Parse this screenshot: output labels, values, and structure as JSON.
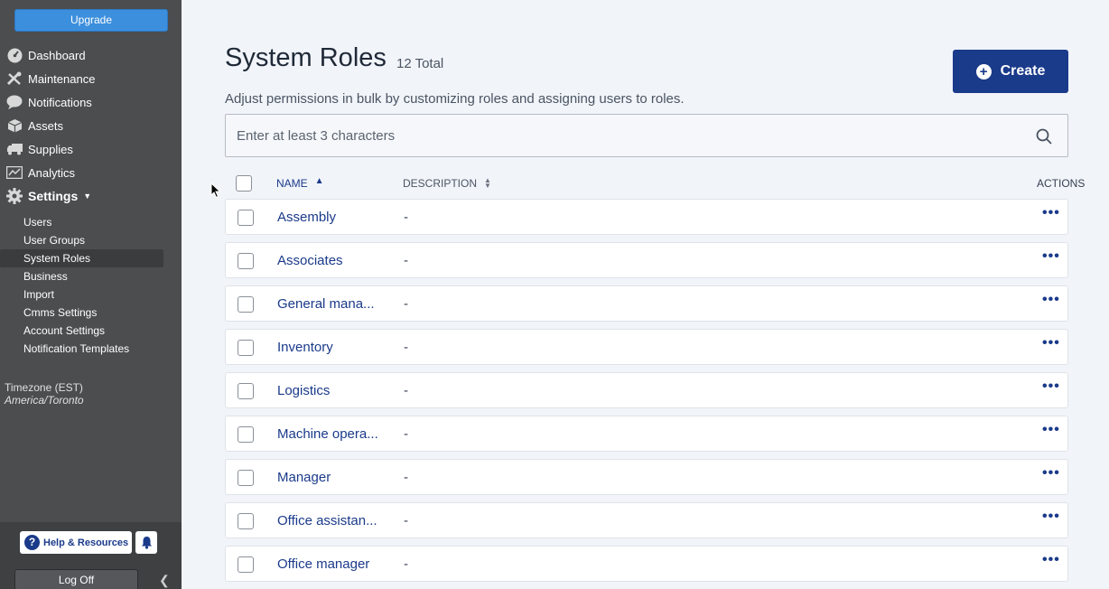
{
  "sidebar": {
    "upgrade_label": "Upgrade",
    "nav": [
      {
        "label": "Dashboard",
        "icon": "dashboard-icon"
      },
      {
        "label": "Maintenance",
        "icon": "tools-icon"
      },
      {
        "label": "Notifications",
        "icon": "chat-bubble-icon"
      },
      {
        "label": "Assets",
        "icon": "box-icon"
      },
      {
        "label": "Supplies",
        "icon": "truck-icon"
      },
      {
        "label": "Analytics",
        "icon": "chart-icon"
      },
      {
        "label": "Settings",
        "icon": "gear-icon"
      }
    ],
    "settings_items": [
      {
        "label": "Users"
      },
      {
        "label": "User Groups"
      },
      {
        "label": "System Roles"
      },
      {
        "label": "Business"
      },
      {
        "label": "Import"
      },
      {
        "label": "Cmms Settings"
      },
      {
        "label": "Account Settings"
      },
      {
        "label": "Notification Templates"
      }
    ],
    "timezone_label": "Timezone (EST)",
    "timezone_name": "America/Toronto",
    "help_label": "Help & Resources",
    "logoff_label": "Log Off"
  },
  "page": {
    "title": "System Roles",
    "total": "12 Total",
    "subtitle": "Adjust permissions in bulk by customizing roles and assigning users to roles.",
    "create_label": "Create",
    "search_placeholder": "Enter at least 3 characters"
  },
  "table": {
    "columns": {
      "name": "NAME",
      "description": "DESCRIPTION",
      "actions": "ACTIONS"
    },
    "rows": [
      {
        "name": "Assembly",
        "description": "-"
      },
      {
        "name": "Associates",
        "description": "-"
      },
      {
        "name": "General mana...",
        "description": "-"
      },
      {
        "name": "Inventory",
        "description": "-"
      },
      {
        "name": "Logistics",
        "description": "-"
      },
      {
        "name": "Machine opera...",
        "description": "-"
      },
      {
        "name": "Manager",
        "description": "-"
      },
      {
        "name": "Office assistan...",
        "description": "-"
      },
      {
        "name": "Office manager",
        "description": "-"
      }
    ],
    "actions_glyph": "•••"
  },
  "colors": {
    "sidebar": "#4b4d4f",
    "accent": "#1a3a8a",
    "upgrade": "#3c8fdd"
  }
}
